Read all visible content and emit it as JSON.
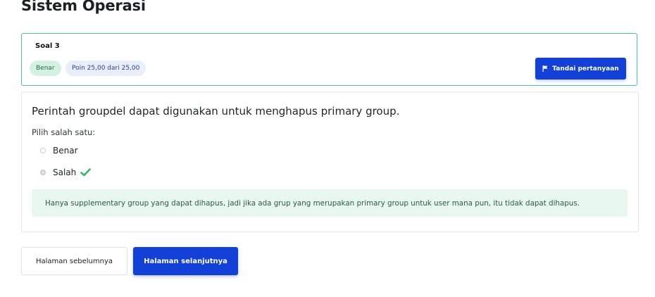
{
  "page": {
    "title": "Sistem Operasi"
  },
  "question": {
    "number_label": "Soal 3",
    "status_badge": "Benar",
    "points_badge": "Poin 25,00 dari 25,00",
    "flag_button_label": "Tandai pertanyaan",
    "text": "Perintah groupdel dapat digunakan untuk menghapus primary group.",
    "choose_label": "Pilih salah satu:",
    "options": [
      {
        "label": "Benar",
        "selected": false
      },
      {
        "label": "Salah",
        "selected": true,
        "marked_correct": true
      }
    ],
    "feedback": "Hanya supplementary group yang dapat dihapus, jadi jika ada grup yang merupakan primary group untuk user mana pun, itu tidak dapat dihapus."
  },
  "navigation": {
    "prev_label": "Halaman sebelumnya",
    "next_label": "Halaman selanjutnya"
  },
  "colors": {
    "primary": "#1340d6",
    "correct_border": "#4cc09a",
    "correct_check": "#2fb865",
    "feedback_bg": "#e8f7ef"
  },
  "icons": {
    "flag": "flag-icon",
    "check": "check-icon"
  }
}
